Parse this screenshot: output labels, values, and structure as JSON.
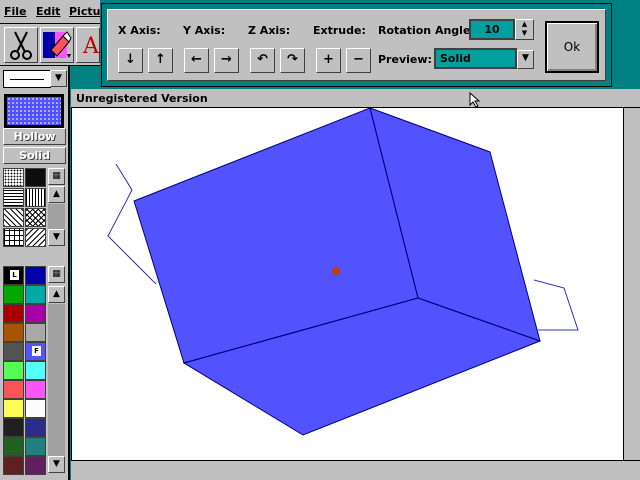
{
  "menu": {
    "file": "File",
    "edit": "Edit",
    "picture": "Pictu"
  },
  "left": {
    "hollow_label": "Hollow",
    "solid_label": "Solid",
    "swatch_L": "L",
    "swatch_F": "F",
    "colors": [
      "#000000",
      "#0000a8",
      "#00a800",
      "#00a8a8",
      "#a80000",
      "#a800a8",
      "#a85400",
      "#a8a8a8",
      "#545454",
      "#5454fc",
      "#54fc54",
      "#54fcfc",
      "#fc5454",
      "#fc54fc",
      "#fcfc54",
      "#fcfcfc",
      "#202020",
      "#2c2c8c",
      "#206020",
      "#208080",
      "#602020",
      "#602060"
    ]
  },
  "dialog": {
    "x_axis": "X Axis:",
    "y_axis": "Y Axis:",
    "z_axis": "Z Axis:",
    "extrude": "Extrude:",
    "rotation_label": "Rotation Angle:",
    "rotation_value": "10",
    "preview_label": "Preview:",
    "preview_value": "Solid",
    "ok": "Ok",
    "x_down": "↓",
    "x_up": "↑",
    "y_left": "←",
    "y_right": "→",
    "z_ccw": "↶",
    "z_cw": "↷",
    "ext_plus": "+",
    "ext_minus": "−"
  },
  "document": {
    "title": "Unregistered Version"
  },
  "colors": {
    "cube_fill": "#5252ff",
    "cube_edge": "#000080",
    "center_dot": "#c04000",
    "accent": "#008080"
  }
}
